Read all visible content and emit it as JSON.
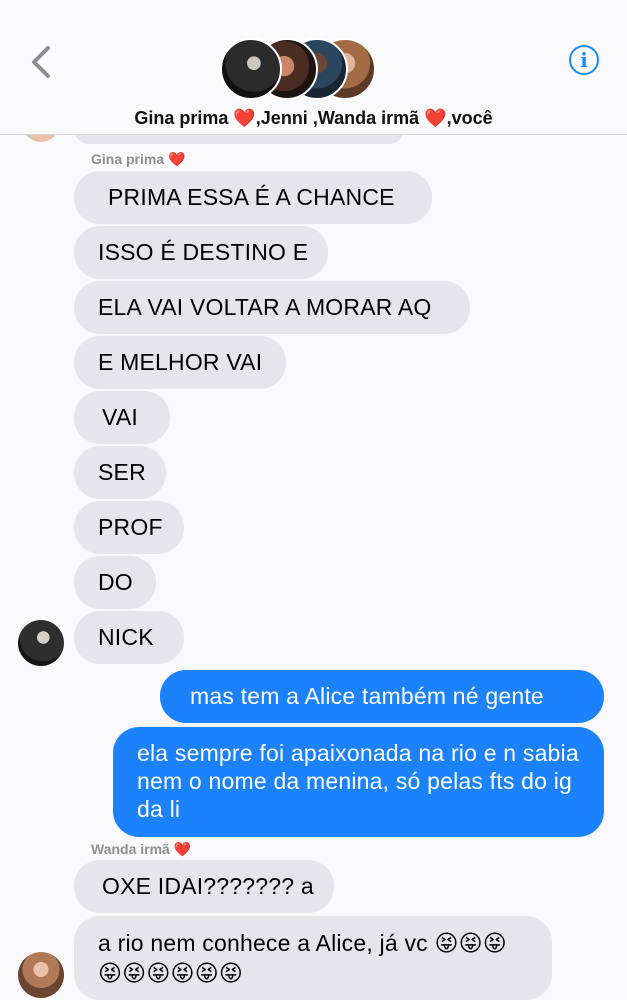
{
  "header": {
    "back_icon": "chevron-left-icon",
    "group_name": "Gina prima ❤️,Jenni ,Wanda irmã ❤️,você",
    "info_icon": "info-icon",
    "info_glyph": "i",
    "accent_color": "#1a8cff"
  },
  "messages": [
    {
      "sender": "Gina prima ❤️"
    },
    {
      "text": "PRIMA ESSA É A CHANCE"
    },
    {
      "text": "ISSO É DESTINO E"
    },
    {
      "text": "ELA VAI VOLTAR A MORAR AQ"
    },
    {
      "text": "E MELHOR VAI"
    },
    {
      "text": "VAI"
    },
    {
      "text": "SER"
    },
    {
      "text": "PROF"
    },
    {
      "text": "DO"
    },
    {
      "text": "NICK"
    },
    {
      "text": "mas tem a Alice também né gente"
    },
    {
      "text": "ela sempre foi apaixonada na rio e n sabia nem o nome da menina, só pelas fts do ig da li"
    },
    {
      "sender": "Wanda irmã ❤️"
    },
    {
      "text": "OXE IDAI??????? a"
    },
    {
      "text": "a rio nem conhece a Alice, já vc 😝😝😝😝😝😝😝😝😝"
    }
  ],
  "colors": {
    "incoming_bubble": "#e6e6ea",
    "outgoing_bubble": "#1b82fb",
    "background": "#f9f9fb"
  }
}
